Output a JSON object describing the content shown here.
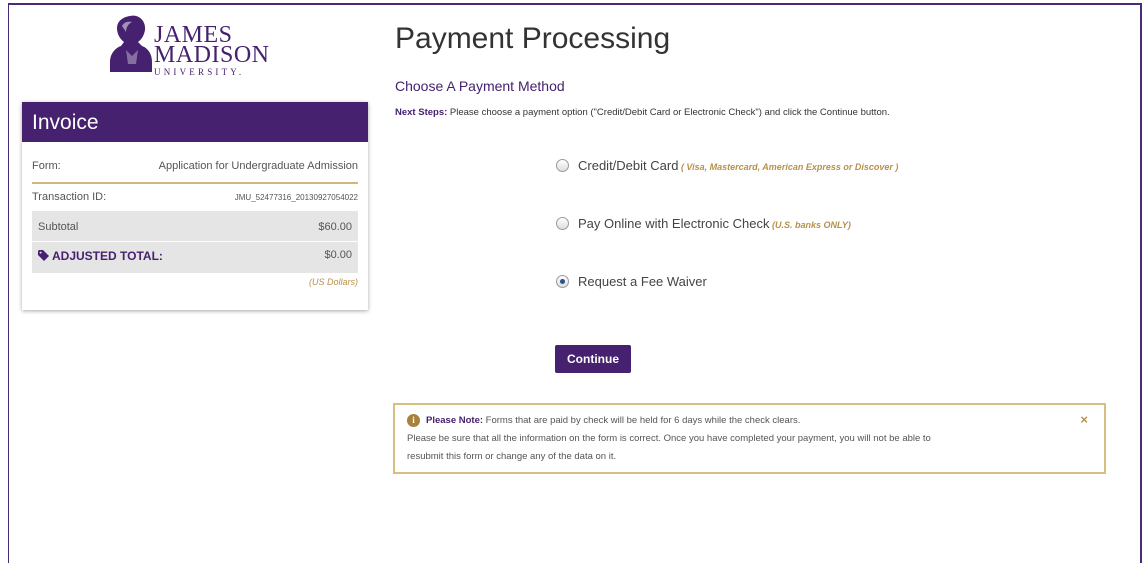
{
  "logo": {
    "line1": "JAMES",
    "line2": "MADISON",
    "line3": "UNIVERSITY."
  },
  "invoice": {
    "title": "Invoice",
    "form_label": "Form:",
    "form_value": "Application for Undergraduate Admission",
    "tx_label": "Transaction ID:",
    "tx_value": "JMU_52477316_20130927054022",
    "subtotal_label": "Subtotal",
    "subtotal_value": "$60.00",
    "adjusted_label": "ADJUSTED TOTAL:",
    "adjusted_value": "$0.00",
    "currency": "(US Dollars)"
  },
  "main": {
    "title": "Payment Processing",
    "subtitle": "Choose A Payment Method",
    "next_label": "Next Steps:",
    "next_text": " Please choose a payment option (\"Credit/Debit Card or Electronic Check\") and click the Continue button."
  },
  "options": [
    {
      "label": "Credit/Debit Card",
      "hint": " ( Visa, Mastercard, American Express or Discover )",
      "selected": false
    },
    {
      "label": "Pay Online with Electronic Check",
      "hint": " (U.S. banks ONLY)",
      "selected": false
    },
    {
      "label": "Request a Fee Waiver",
      "hint": "",
      "selected": true
    }
  ],
  "continue_label": "Continue",
  "note": {
    "icon": "i",
    "label": "Please Note:",
    "line1": " Forms that are paid by check will be held for 6 days while the check clears.",
    "line2": "Please be sure that all the information on the form is correct. Once you have completed your payment, you will not be able to",
    "line3": "resubmit this form or change any of the data on it.",
    "close": "×"
  },
  "colors": {
    "brand_purple": "#45216f",
    "gold": "#cfb87a",
    "hint_gold": "#b8914a"
  }
}
